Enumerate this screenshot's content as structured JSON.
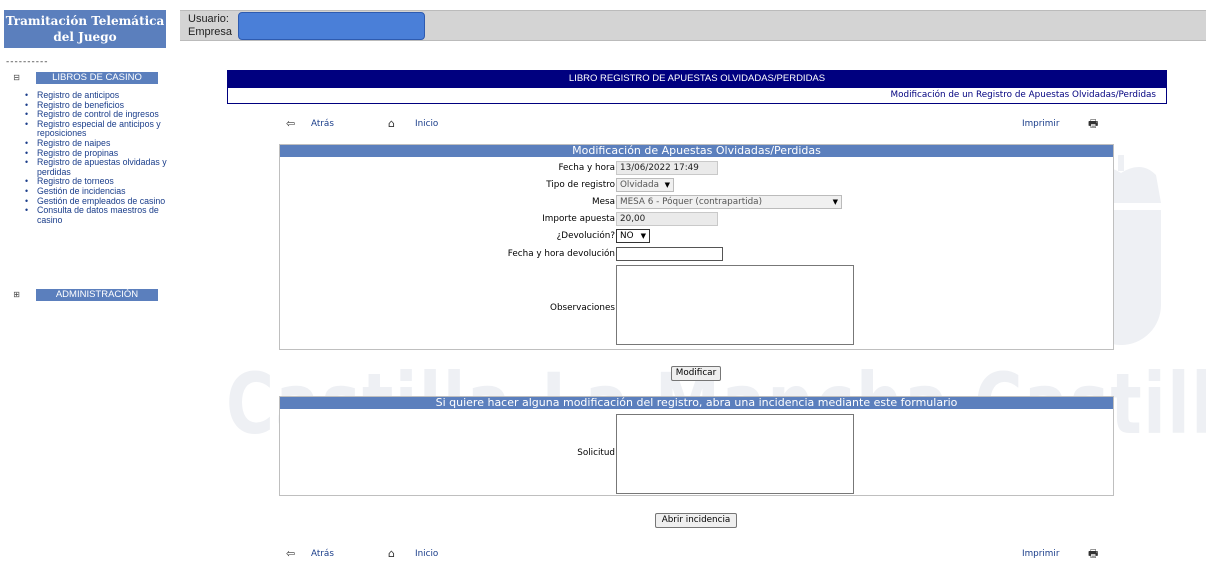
{
  "brand": {
    "line1": "Tramitación Telemática",
    "line2": "del Juego"
  },
  "sidebar": {
    "dashes": "----------",
    "section1": {
      "toggle": "⊟",
      "label": "LIBROS DE CASINO"
    },
    "section2": {
      "toggle": "⊞",
      "label": "ADMINISTRACIÓN"
    },
    "items": [
      "Registro de anticipos",
      "Registro de beneficios",
      "Registro de control de ingresos",
      "Registro especial de anticipos y reposiciones",
      "Registro de naipes",
      "Registro de propinas",
      "Registro de apuestas olvidadas y perdidas",
      "Registro de torneos",
      "Gestión de incidencias",
      "Gestión de empleados de casino",
      "Consulta de datos maestros de casino"
    ]
  },
  "header": {
    "usuario_label": "Usuario:",
    "empresa_label": "Empresa"
  },
  "page": {
    "title": "LIBRO REGISTRO DE APUESTAS OLVIDADAS/PERDIDAS",
    "subtitle": "Modificación de un Registro de Apuestas Olvidadas/Perdidas"
  },
  "nav": {
    "back": "Atrás",
    "home": "Inicio",
    "print": "Imprimir",
    "back_icon": "⇦",
    "home_icon": "⌂",
    "print_icon": "🖶"
  },
  "form": {
    "title": "Modificación de Apuestas Olvidadas/Perdidas",
    "fecha_label": "Fecha y hora",
    "fecha_value": "13/06/2022 17:49",
    "tipo_label": "Tipo de registro",
    "tipo_value": "Olvidada",
    "mesa_label": "Mesa",
    "mesa_value": "MESA 6 - Póquer (contrapartida)",
    "importe_label": "Importe apuesta",
    "importe_value": "20,00",
    "devolucion_label": "¿Devolución?",
    "devolucion_value": "NO",
    "fecha_dev_label": "Fecha y hora devolución",
    "fecha_dev_value": "",
    "obs_label": "Observaciones",
    "submit": "Modificar"
  },
  "incidencia": {
    "title": "Si quiere hacer alguna modificación del registro, abra una incidencia mediante este formulario",
    "solicitud_label": "Solicitud",
    "submit": "Abrir incidencia"
  },
  "watermark": {
    "text": "Castilla-La Mancha    Castilla-La Ma"
  }
}
